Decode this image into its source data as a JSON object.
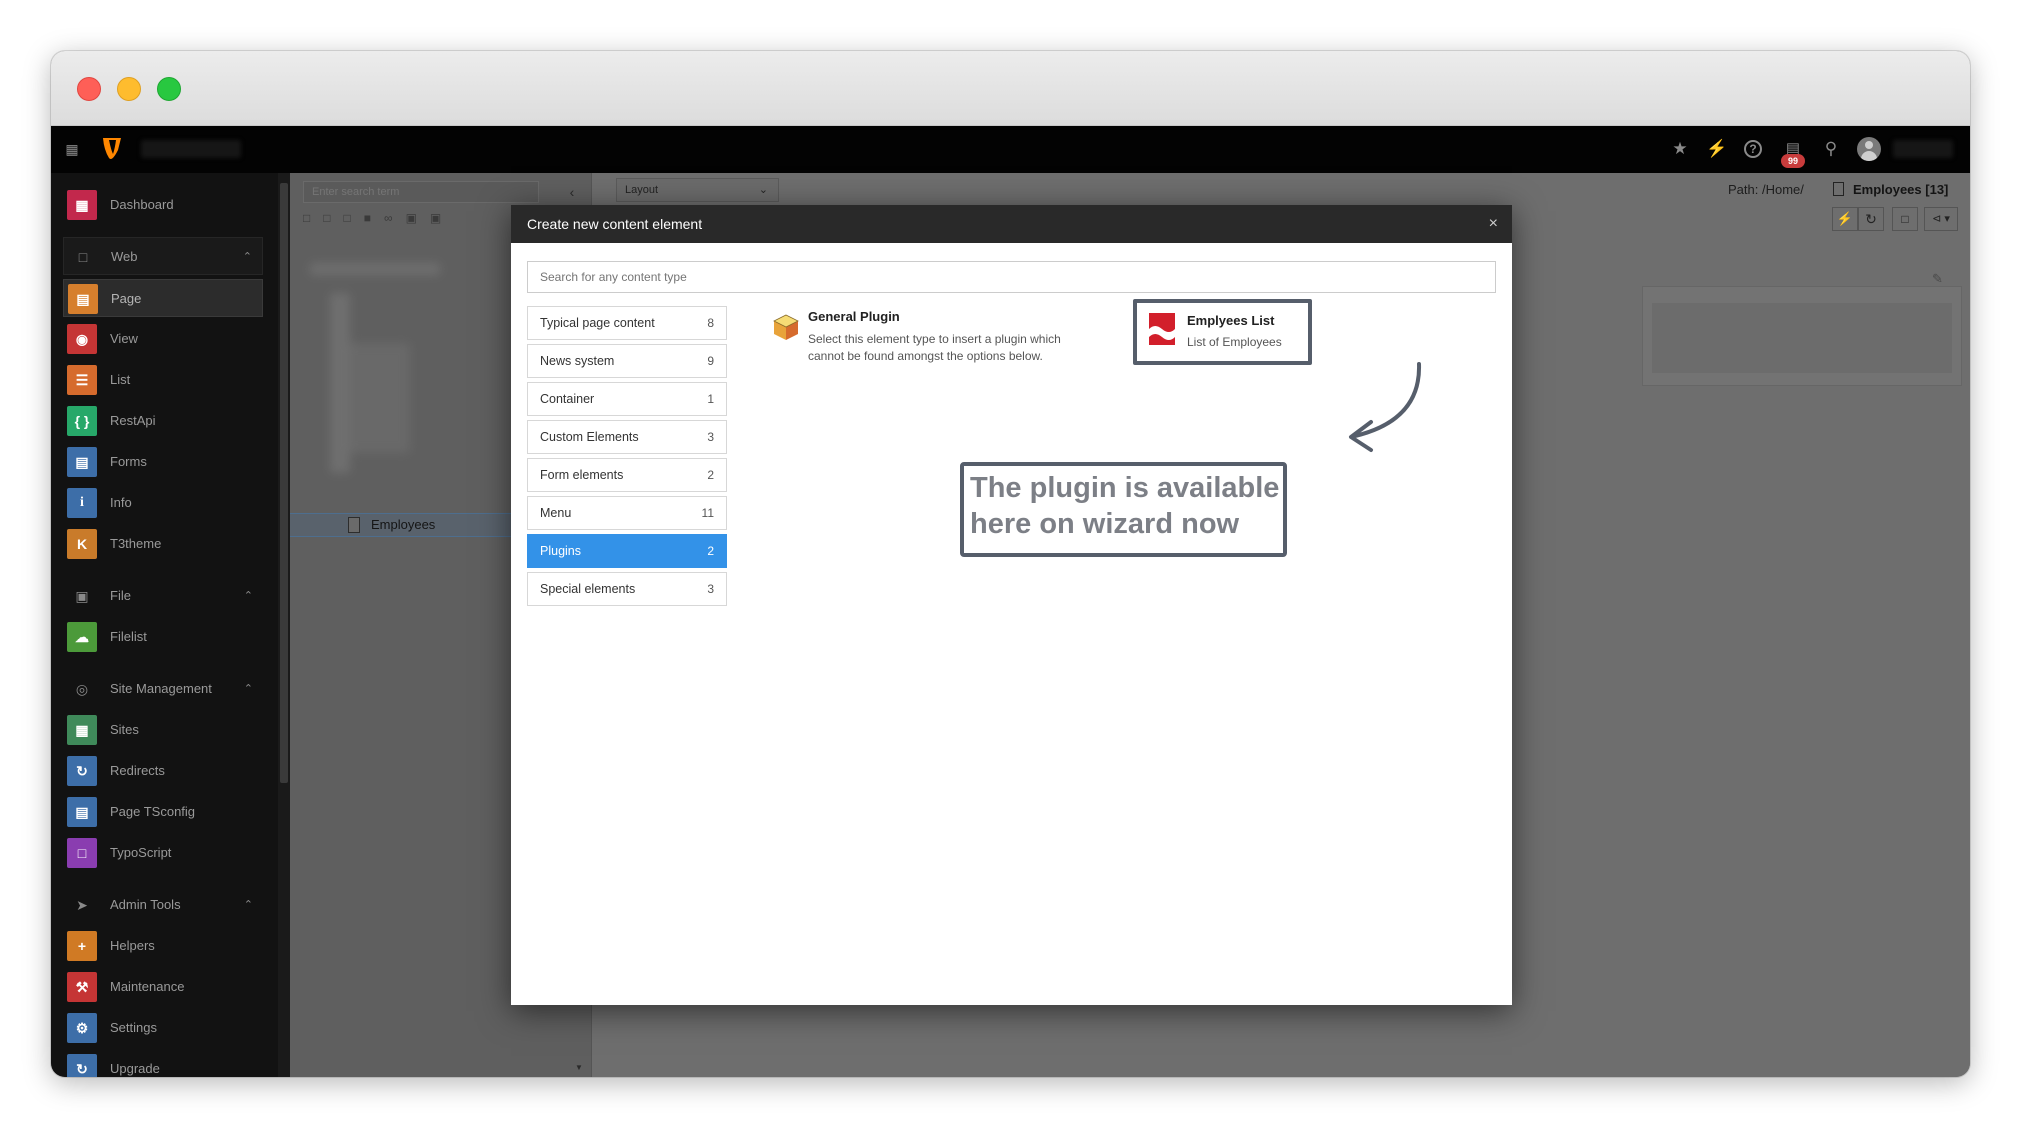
{
  "window": {
    "traffic_lights": [
      "#fe5f57",
      "#febc2e",
      "#28c840"
    ]
  },
  "topbar": {
    "notification_count": "99",
    "icons": [
      "bookmark-star-icon",
      "flash-icon",
      "help-icon",
      "system-info-icon",
      "search-icon",
      "user-avatar-icon"
    ]
  },
  "sidebar": {
    "dashboard": {
      "label": "Dashboard",
      "color": "#c2284c"
    },
    "groups": [
      {
        "label": "Web",
        "items": [
          {
            "label": "Page",
            "color": "#d67f2d"
          },
          {
            "label": "View",
            "color": "#c53535"
          },
          {
            "label": "List",
            "color": "#d66b2d"
          },
          {
            "label": "RestApi",
            "color": "#27a869"
          },
          {
            "label": "Forms",
            "color": "#3d6ea8"
          },
          {
            "label": "Info",
            "color": "#3d6ea8"
          },
          {
            "label": "T3theme",
            "color": "#c97b2a"
          }
        ]
      },
      {
        "label": "File",
        "items": [
          {
            "label": "Filelist",
            "color": "#4c9a3a"
          }
        ]
      },
      {
        "label": "Site Management",
        "items": [
          {
            "label": "Sites",
            "color": "#3f8a5a"
          },
          {
            "label": "Redirects",
            "color": "#3d6ea8"
          },
          {
            "label": "Page TSconfig",
            "color": "#3d6ea8"
          },
          {
            "label": "TypoScript",
            "color": "#8a3db0"
          }
        ]
      },
      {
        "label": "Admin Tools",
        "items": [
          {
            "label": "Helpers",
            "color": "#d07a24"
          },
          {
            "label": "Maintenance",
            "color": "#c53535"
          },
          {
            "label": "Settings",
            "color": "#3d6ea8"
          },
          {
            "label": "Upgrade",
            "color": "#3d6ea8"
          }
        ]
      }
    ]
  },
  "tree": {
    "search_placeholder": "Enter search term",
    "selected_page": "Employees"
  },
  "docheader": {
    "layout_select": "Layout",
    "path_label": "Path: /Home/",
    "page_title": "Employees [13]"
  },
  "modal": {
    "title": "Create new content element",
    "close": "×",
    "search_placeholder": "Search for any content type",
    "categories": [
      {
        "label": "Typical page content",
        "count": "8"
      },
      {
        "label": "News system",
        "count": "9"
      },
      {
        "label": "Container",
        "count": "1"
      },
      {
        "label": "Custom Elements",
        "count": "3"
      },
      {
        "label": "Form elements",
        "count": "2"
      },
      {
        "label": "Menu",
        "count": "11"
      },
      {
        "label": "Plugins",
        "count": "2",
        "active": true
      },
      {
        "label": "Special elements",
        "count": "3"
      }
    ],
    "items": [
      {
        "title": "General Plugin",
        "desc_line1": "Select this element type to insert a plugin which",
        "desc_line2": "cannot be found amongst the options below."
      },
      {
        "title": "Emplyees List",
        "desc_line1": "List of Employees"
      }
    ]
  },
  "annotation": {
    "line1": "The plugin is available",
    "line2": "here on wizard now"
  }
}
